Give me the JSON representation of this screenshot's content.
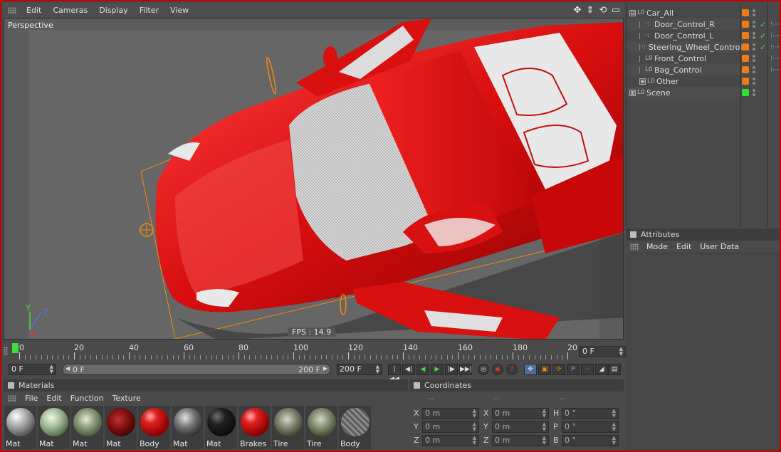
{
  "menubar": {
    "items": [
      "Edit",
      "Cameras",
      "Display",
      "Filter",
      "View"
    ],
    "nav_icons": [
      "move-icon",
      "dolly-icon",
      "rotate-icon",
      "maximize-icon"
    ]
  },
  "viewport": {
    "label": "Perspective",
    "fps": "FPS : 14.9",
    "axis_y": "Y",
    "axis_z": "Z",
    "axis_x": "X"
  },
  "objects": [
    {
      "name": "Car_All",
      "indent": 0,
      "expander": "⊟",
      "icon": "null-object-icon",
      "glyph": "L0",
      "color": "#f07a14",
      "check": false,
      "tag": false
    },
    {
      "name": "Door_Control_R",
      "indent": 1,
      "expander": "",
      "icon": "joint-icon",
      "glyph": "·:",
      "color": "#f07a14",
      "check": true,
      "tag": true
    },
    {
      "name": "Door_Control_L",
      "indent": 1,
      "expander": "",
      "icon": "joint-icon",
      "glyph": "·:",
      "color": "#f07a14",
      "check": true,
      "tag": true
    },
    {
      "name": "Steering_Wheel_Control",
      "indent": 1,
      "expander": "",
      "icon": "joint-icon",
      "glyph": "·:",
      "color": "#f07a14",
      "check": true,
      "tag": true
    },
    {
      "name": "Front_Control",
      "indent": 1,
      "expander": "",
      "icon": "null-object-icon",
      "glyph": "L0",
      "color": "#f07a14",
      "check": false,
      "tag": true
    },
    {
      "name": "Bag_Control",
      "indent": 1,
      "expander": "",
      "icon": "null-object-icon",
      "glyph": "L0",
      "color": "#f07a14",
      "check": false,
      "tag": true
    },
    {
      "name": "Other",
      "indent": 1,
      "expander": "⊞",
      "icon": "null-object-icon",
      "glyph": "L0",
      "color": "#f07a14",
      "check": false,
      "tag": false
    },
    {
      "name": "Scene",
      "indent": 0,
      "expander": "⊞",
      "icon": "null-object-icon",
      "glyph": "L0",
      "color": "#30e030",
      "check": false,
      "tag": false
    }
  ],
  "attributes": {
    "title": "Attributes",
    "menu": [
      "Mode",
      "Edit",
      "User Data"
    ]
  },
  "timeline": {
    "ticks": [
      "0",
      "20",
      "40",
      "60",
      "80",
      "100",
      "120",
      "140",
      "160",
      "180",
      "20"
    ],
    "current_frame": "0 F",
    "start_field": "0 F",
    "range_start": "0 F",
    "range_end": "200 F",
    "end_field": "200 F"
  },
  "materials": {
    "title": "Materials",
    "menu": [
      "File",
      "Edit",
      "Function",
      "Texture"
    ],
    "items": [
      {
        "label": "Mat",
        "bg": "radial-gradient(circle at 35% 30%, #ffffff 0%, #b8b8b8 30%, #4a4a4a 80%, #2a2a2a 100%)"
      },
      {
        "label": "Mat",
        "bg": "radial-gradient(circle at 40% 35%, #f0f8e0 0%, #a8c0a0 35%, #607850 70%, #303828 100%)"
      },
      {
        "label": "Mat",
        "bg": "radial-gradient(circle at 45% 40%, #e8e8d8 0%, #90a080 35%, #506040 70%, #303020 100%)"
      },
      {
        "label": "Mat",
        "bg": "radial-gradient(circle at 40% 40%, #c03030 0%, #801010 40%, #400000 80%, #200000 100%)"
      },
      {
        "label": "Body",
        "bg": "radial-gradient(circle at 35% 30%, #ffb0b0 0%, #e02020 25%, #900000 70%, #400000 100%)"
      },
      {
        "label": "Mat",
        "bg": "radial-gradient(circle at 40% 35%, #e0e0e0 0%, #707070 40%, #202020 85%, #101010 100%)"
      },
      {
        "label": "Mat",
        "bg": "radial-gradient(circle at 35% 30%, #707070 0%, #202020 30%, #080808 80%, #000000 100%)"
      },
      {
        "label": "Brakes",
        "bg": "radial-gradient(circle at 35% 30%, #ffb0b0 0%, #e02020 25%, #900000 70%, #400000 100%)"
      },
      {
        "label": "Tire",
        "bg": "radial-gradient(circle at 45% 40%, #d8d8c8 0%, #8a8a78 35%, #4a4a38 70%, #282818 100%)"
      },
      {
        "label": "Tire",
        "bg": "radial-gradient(circle at 45% 40%, #d0d8c8 0%, #8a9478 35%, #4a5438 70%, #283018 100%)"
      },
      {
        "label": "Body",
        "bg": "repeating-linear-gradient(45deg, #8a8a8a 0 3px, #5a5a5a 3px 6px)"
      }
    ]
  },
  "coordinates": {
    "title": "Coordinates",
    "sub": [
      "--",
      "--",
      "--"
    ],
    "rows": [
      [
        {
          "axis": "X",
          "value": "0 m"
        },
        {
          "axis": "X",
          "value": "0 m"
        },
        {
          "axis": "H",
          "value": "0 °"
        }
      ],
      [
        {
          "axis": "Y",
          "value": "0 m"
        },
        {
          "axis": "Y",
          "value": "0 m"
        },
        {
          "axis": "P",
          "value": "0 °"
        }
      ],
      [
        {
          "axis": "Z",
          "value": "0 m"
        },
        {
          "axis": "Z",
          "value": "0 m"
        },
        {
          "axis": "B",
          "value": "0 °"
        }
      ]
    ]
  },
  "colors": {
    "accent_red": "#c40000",
    "car_red": "#d80e0e",
    "selection_orange": "#f08a10",
    "playhead_green": "#3fdc3f"
  }
}
